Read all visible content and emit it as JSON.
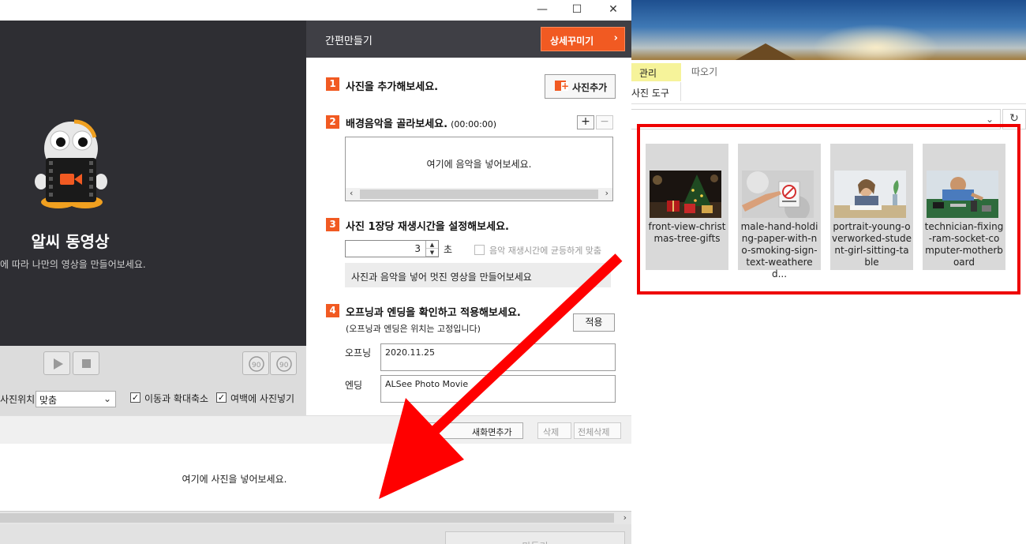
{
  "explorer": {
    "tab_manage": "관리",
    "tab_picture_tools": "사진 도구",
    "tab_extract": "따오기",
    "addr_chevron": "⌄",
    "refresh": "↻",
    "files": [
      {
        "name": "front-view-christmas-tree-gifts",
        "label": "front-view-christ mas-tree-gifts"
      },
      {
        "name": "male-hand-holding-paper-with-no-smoking-sign-text-weathered",
        "label": "male-hand-holdi ng-paper-with-n o-smoking-sign- text-weathered..."
      },
      {
        "name": "portrait-young-overworked-student-girl-sitting-table",
        "label": "portrait-young-o verworked-stude nt-girl-sitting-ta ble"
      },
      {
        "name": "technician-fixing-ram-socket-computer-motherboard",
        "label": "technician-fixing -ram-socket-co mputer-motherb oard"
      }
    ]
  },
  "dialog": {
    "window_buttons": {
      "minimize": "—",
      "maximize": "☐",
      "close": "✕"
    },
    "preview": {
      "app_name": "알씨 동영상",
      "description": "에 따라 나만의 영상을 만들어보세요."
    },
    "controls": {
      "position_label": "사진위치",
      "position_value": "맞춤",
      "chk_move_zoom": "이동과 확대축소",
      "chk_margin": "여백에 사진넣기"
    },
    "panel": {
      "title": "간편만들기",
      "detail_button": "상세꾸미기",
      "step1": {
        "num": "1",
        "title": "사진을 추가해보세요.",
        "button": "사진추가"
      },
      "step2": {
        "num": "2",
        "title": "배경음악을 골라보세요.",
        "duration": "(00:00:00)",
        "add": "+",
        "remove": "−",
        "hint": "여기에 음악을 넣어보세요."
      },
      "step3": {
        "num": "3",
        "title": "사진 1장당 재생시간을 설정해보세요.",
        "value": "3",
        "unit": "초",
        "even_label": "음악 재생시간에 균등하게 맞춤",
        "hint": "사진과 음악을 넣어 멋진 영상을 만들어보세요"
      },
      "step4": {
        "num": "4",
        "title": "오프닝과 엔딩을 확인하고 적용해보세요.",
        "note": "(오프닝과 엔딩은 위치는 고정입니다)",
        "apply": "적용",
        "opening_label": "오프닝",
        "opening_value": "2020.11.25",
        "ending_label": "엔딩",
        "ending_value": "ALSee Photo Movie"
      }
    },
    "toolbar": {
      "add_blank": "새화면추가",
      "delete": "삭제",
      "delete_all": "전체삭제"
    },
    "photo_drop_hint": "여기에 사진을 넣어보세요.",
    "make_button": "만들기"
  },
  "colors": {
    "accent": "#f15a22",
    "highlight_box": "#ee0000",
    "arrow": "#ff0000"
  }
}
